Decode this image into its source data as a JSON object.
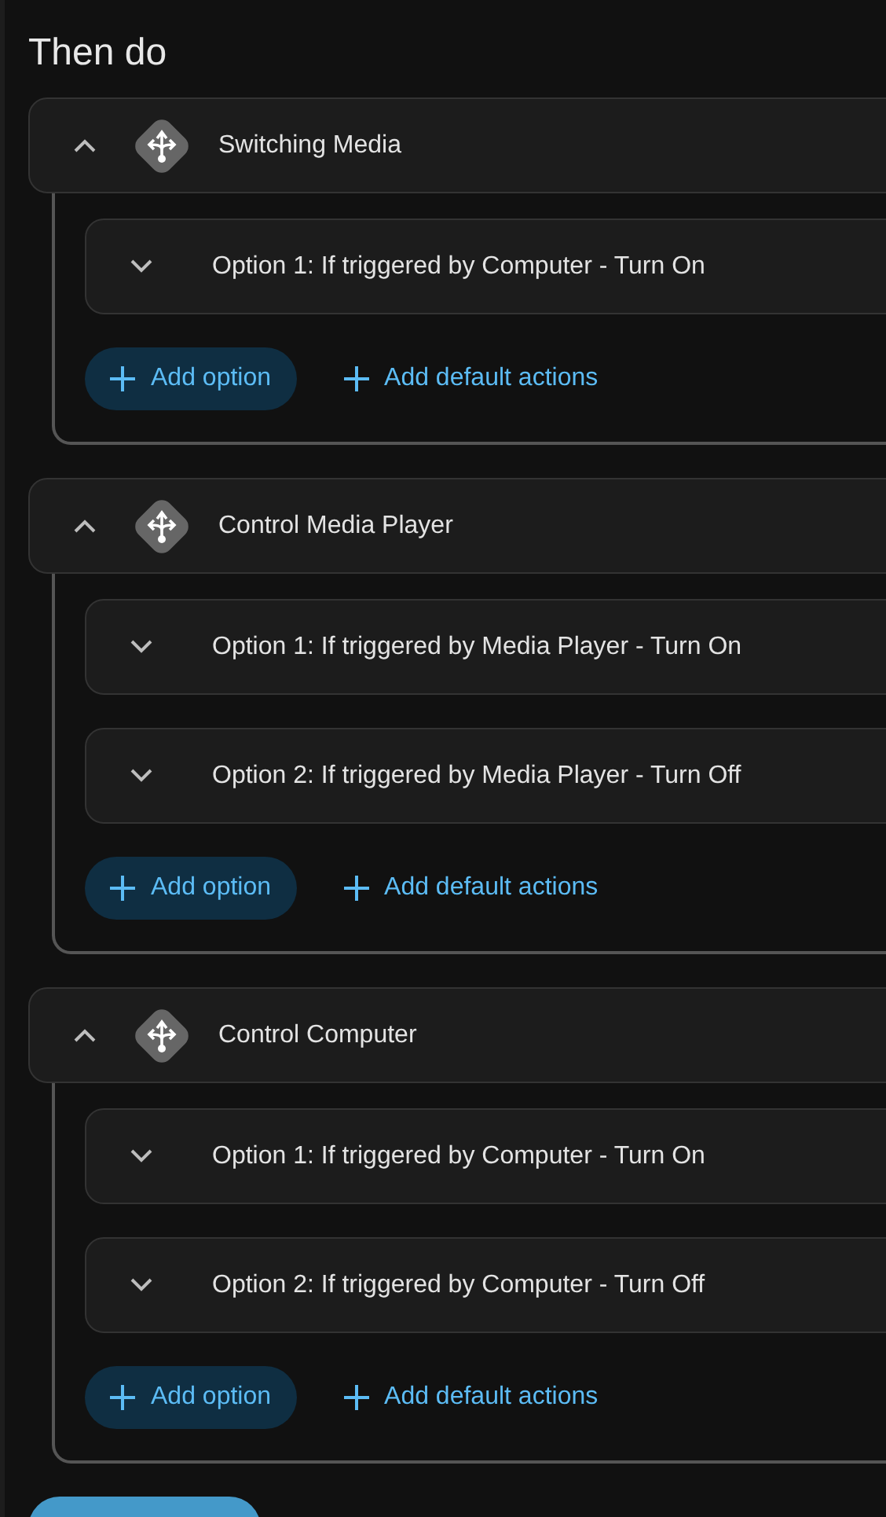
{
  "title": "Then do",
  "sections": [
    {
      "name": "Switching Media",
      "expanded": true,
      "options": [
        {
          "label": "Option 1: If triggered by Computer - Turn On",
          "expanded": false
        }
      ],
      "add_option": "Add option",
      "add_default": "Add default actions"
    },
    {
      "name": "Control Media Player",
      "expanded": true,
      "options": [
        {
          "label": "Option 1: If triggered by Media Player - Turn On",
          "expanded": false
        },
        {
          "label": "Option 2: If triggered by Media Player - Turn Off",
          "expanded": false
        }
      ],
      "add_option": "Add option",
      "add_default": "Add default actions"
    },
    {
      "name": "Control Computer",
      "expanded": true,
      "options": [
        {
          "label": "Option 1: If triggered by Computer - Turn On",
          "expanded": false
        },
        {
          "label": "Option 2: If triggered by Computer - Turn Off",
          "expanded": false
        }
      ],
      "add_option": "Add option",
      "add_default": "Add default actions"
    }
  ]
}
